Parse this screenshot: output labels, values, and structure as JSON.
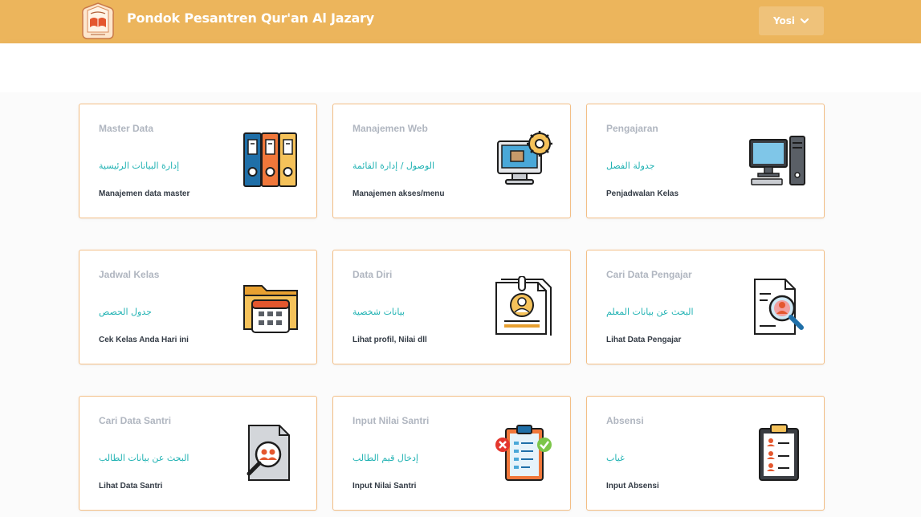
{
  "header": {
    "brand": "Pondok Pesantren Qur'an Al Jazary",
    "user": "Yosi"
  },
  "cards": [
    {
      "title": "Master Data",
      "arabic": "إدارة البيانات الرئيسية",
      "desc": "Manajemen data master",
      "icon": "binders-icon"
    },
    {
      "title": "Manajemen Web",
      "arabic": "الوصول / إدارة القائمة",
      "desc": "Manajemen akses/menu",
      "icon": "monitor-gear-icon"
    },
    {
      "title": "Pengajaran",
      "arabic": "جدولة الفصل",
      "desc": "Penjadwalan Kelas",
      "icon": "desktop-computer-icon"
    },
    {
      "title": "Jadwal Kelas",
      "arabic": "جدول الحصص",
      "desc": "Cek Kelas Anda Hari ini",
      "icon": "folder-calendar-icon"
    },
    {
      "title": "Data Diri",
      "arabic": "بيانات شخصية",
      "desc": "Lihat profil, Nilai dll",
      "icon": "profile-document-icon"
    },
    {
      "title": "Cari Data Pengajar",
      "arabic": "البحث عن بيانات المعلم",
      "desc": "Lihat Data Pengajar",
      "icon": "document-search-user-icon"
    },
    {
      "title": "Cari Data Santri",
      "arabic": "البحث عن بيانات الطالب",
      "desc": "Lihat Data Santri",
      "icon": "document-search-users-icon"
    },
    {
      "title": "Input Nilai Santri",
      "arabic": "إدخال قيم الطالب",
      "desc": "Input Nilai Santri",
      "icon": "clipboard-check-icon"
    },
    {
      "title": "Absensi",
      "arabic": "غياب",
      "desc": "Input Absensi",
      "icon": "clipboard-attendance-icon"
    }
  ]
}
